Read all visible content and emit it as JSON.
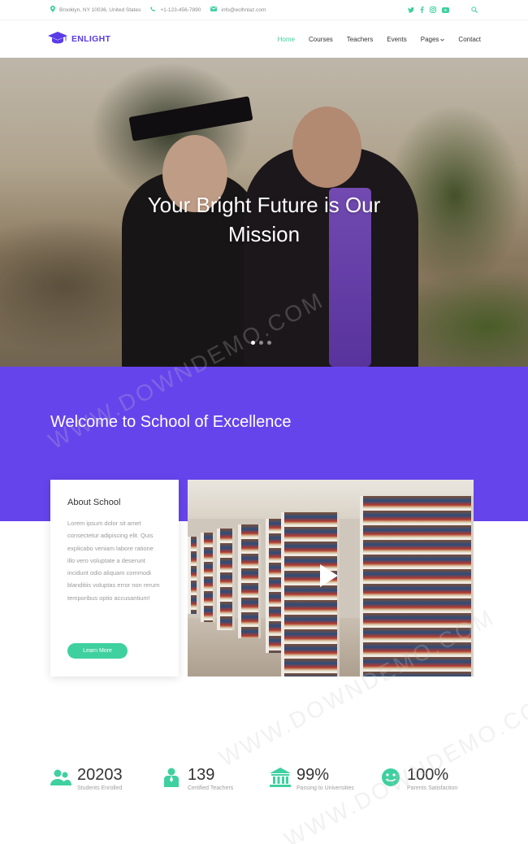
{
  "topbar": {
    "address": "Brooklyn, NY 10036, United States",
    "phone": "+1-123-456-7890",
    "email": "info@eclhnlaz.com"
  },
  "brand": {
    "name": "ENLIGHT"
  },
  "nav": {
    "items": [
      {
        "label": "Home",
        "active": true
      },
      {
        "label": "Courses"
      },
      {
        "label": "Teachers"
      },
      {
        "label": "Events"
      },
      {
        "label": "Pages"
      },
      {
        "label": "Contact"
      }
    ]
  },
  "hero": {
    "title": "Your Bright Future is Our Mission",
    "slides": 3,
    "active_slide": 1
  },
  "welcome": {
    "title": "Welcome to School of Excellence"
  },
  "about": {
    "title": "About School",
    "body": "Lorem ipsum dolor sit amet consectetur adipiscing elit. Quis explicabo veniam labore ratione illo vero voluptate a deserunt incidunt odio aliquam commodi blanditiis voluptas error non rerum temporibus optio accusantium!",
    "button": "Learn More"
  },
  "stats": [
    {
      "value": "20203",
      "label": "Students Enrolled",
      "icon": "students-icon"
    },
    {
      "value": "139",
      "label": "Certified Teachers",
      "icon": "teacher-icon"
    },
    {
      "value": "99%",
      "label": "Passing to Universities",
      "icon": "university-icon"
    },
    {
      "value": "100%",
      "label": "Parents Satisfaction",
      "icon": "smile-icon"
    }
  ],
  "watermark": "WWW.DOWNDEMO.COM",
  "colors": {
    "purple": "#6644ec",
    "green": "#3fd0a0",
    "brand": "#5a3be8"
  }
}
